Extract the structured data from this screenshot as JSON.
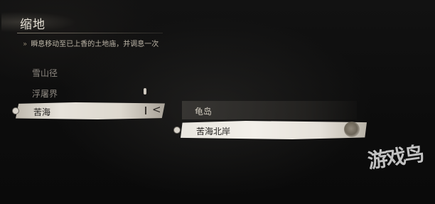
{
  "header": {
    "title": "缩地",
    "description": "瞬息移动至已上香的土地庙，并调息一次",
    "arrow": "»"
  },
  "regions": [
    {
      "label": "雪山径",
      "state": "dim"
    },
    {
      "label": "浮屠界",
      "state": "dim"
    },
    {
      "label": "苦海",
      "state": "selected",
      "chevron": "<"
    }
  ],
  "shrines": [
    {
      "label": "龟岛",
      "state": "normal"
    },
    {
      "label": "苦海北岸",
      "state": "selected"
    }
  ],
  "watermark": "游戏鸟",
  "colors": {
    "selected_bg": "#e6e2da",
    "text_dim": "#8d8880",
    "text_light": "#e4dfd4"
  }
}
